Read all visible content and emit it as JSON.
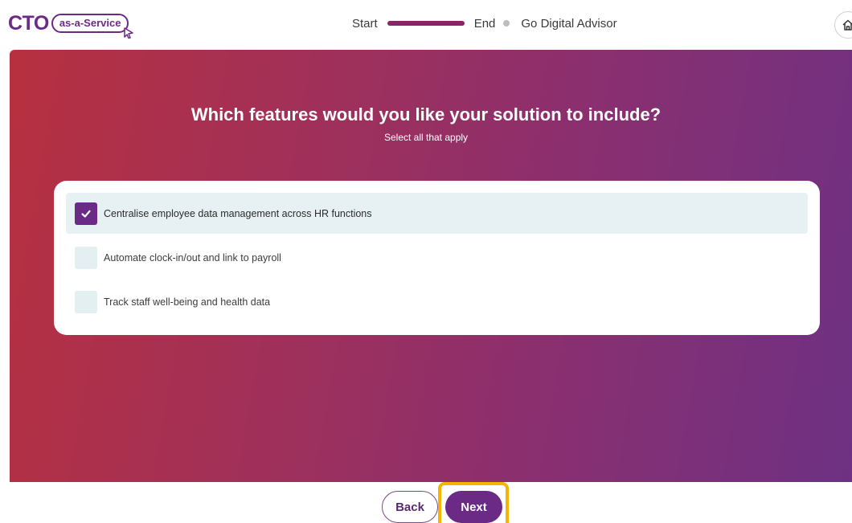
{
  "header": {
    "logo": {
      "primary": "CTO",
      "secondary": "as-a-Service"
    },
    "progress": {
      "start_label": "Start",
      "end_label": "End",
      "progress_fraction": 1.0,
      "brand_label": "Go Digital Advisor"
    },
    "home_icon": "home-icon"
  },
  "question": {
    "title": "Which features would you like your solution to include?",
    "subtitle": "Select all that apply",
    "options": [
      {
        "label": "Centralise employee data management across HR functions",
        "checked": true
      },
      {
        "label": "Automate clock-in/out and link to payroll",
        "checked": false
      },
      {
        "label": "Track staff well-being and health data",
        "checked": false
      }
    ]
  },
  "footer": {
    "back_label": "Back",
    "next_label": "Next"
  },
  "colors": {
    "brand_purple": "#6b2a86",
    "progress_fill": "#8a2468",
    "gradient_start": "#b7303f",
    "gradient_end": "#6e3183",
    "option_selected_bg": "#e7f1f3",
    "highlight": "#f4b400"
  }
}
